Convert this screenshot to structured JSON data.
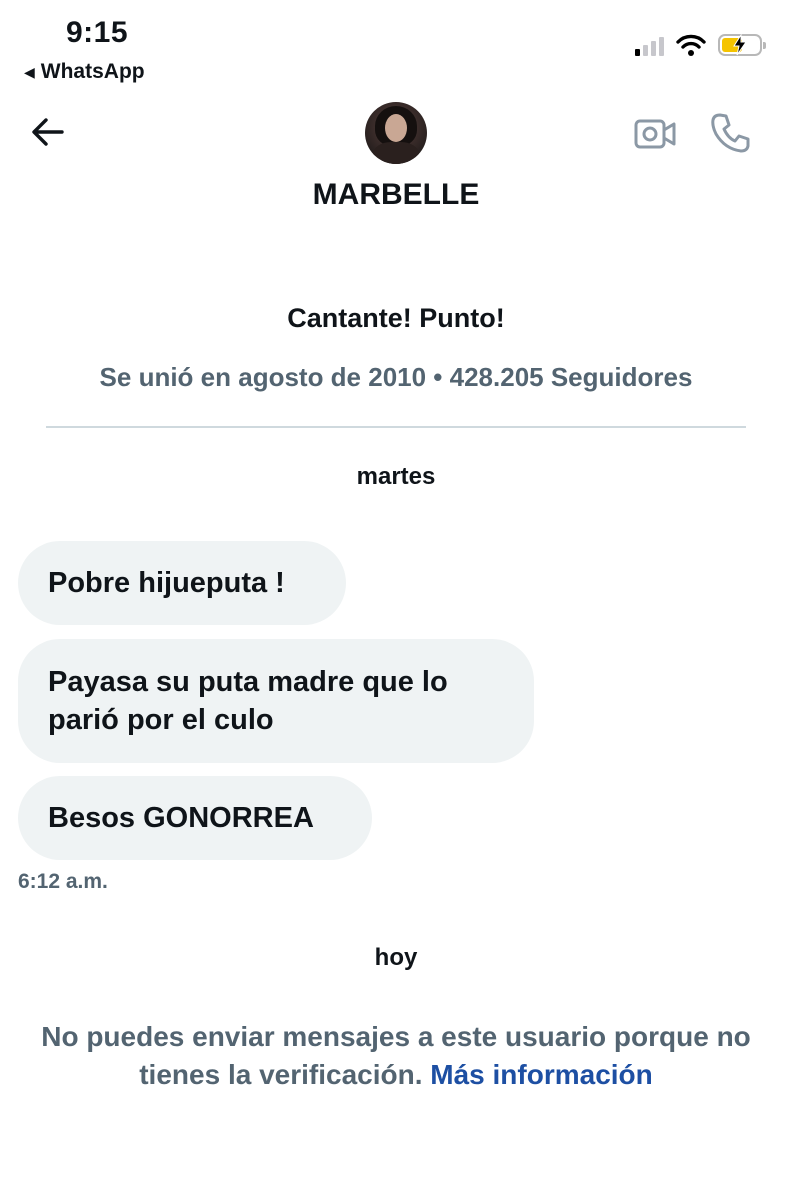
{
  "status_bar": {
    "time": "9:15",
    "back_app": "WhatsApp",
    "icons": [
      "cellular-signal-icon",
      "wifi-icon",
      "battery-charging-icon"
    ]
  },
  "header": {
    "contact_name": "MARBELLE",
    "icons": [
      "back-arrow-icon",
      "video-call-icon",
      "phone-icon"
    ]
  },
  "profile": {
    "bio": "Cantante! Punto!",
    "meta": "Se unió en agosto de 2010 • 428.205 Seguidores"
  },
  "conversation": {
    "day1": "martes",
    "messages": [
      {
        "text": "Pobre hijueputa !"
      },
      {
        "text": "Payasa su puta madre que lo parió por el culo"
      },
      {
        "text": "Besos GONORREA"
      }
    ],
    "last_time": "6:12 a.m.",
    "day2": "hoy"
  },
  "notice": {
    "text": "No puedes enviar mensajes a este usuario porque no tienes la verificación.",
    "link": "Más información"
  },
  "colors": {
    "bubble_bg": "#eff3f4",
    "secondary_text": "#536471",
    "link": "#1d4fa3",
    "battery_fill": "#f5c400"
  }
}
